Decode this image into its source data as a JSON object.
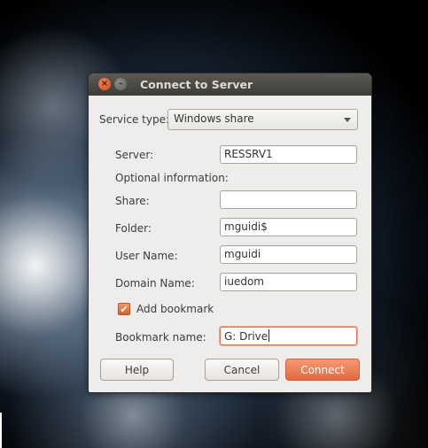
{
  "dialog": {
    "title": "Connect to Server",
    "close_glyph": "×",
    "minimize_glyph": "–"
  },
  "service_type": {
    "label": "Service type:",
    "value": "Windows share"
  },
  "fields": {
    "server": {
      "label": "Server:",
      "value": "RESSRV1"
    },
    "optional_header": "Optional information:",
    "share": {
      "label": "Share:",
      "value": ""
    },
    "folder": {
      "label": "Folder:",
      "value": "mguidi$"
    },
    "user_name": {
      "label": "User Name:",
      "value": "mguidi"
    },
    "domain_name": {
      "label": "Domain Name:",
      "value": "iuedom"
    },
    "bookmark_name": {
      "label": "Bookmark name:",
      "value": "G: Drive"
    }
  },
  "add_bookmark": {
    "label": "Add bookmark",
    "checked": true,
    "check_glyph": "✔"
  },
  "buttons": {
    "help": "Help",
    "cancel": "Cancel",
    "connect": "Connect"
  },
  "colors": {
    "accent": "#e2693e",
    "titlebar": "#3d3c38"
  }
}
